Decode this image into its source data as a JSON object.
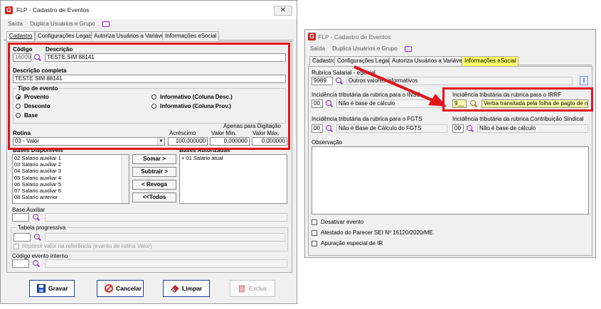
{
  "left_window": {
    "title": "FLP - Cadastro de Eventos",
    "close_label": "✕",
    "menu": {
      "saida": "Saída",
      "duplica": "Duplica Usuários e Grupo"
    },
    "tabs": [
      "Cadastro",
      "Configurações Legais",
      "Autoriza Usuários a Variáveis",
      "Informações eSocial"
    ],
    "codigo_label": "Código",
    "descricao_label": "Descrição",
    "codigo_value": "16000",
    "descricao_value": "TESTE SIM 88141",
    "descricao_completa_label": "Descrição completa",
    "descricao_completa_value": "TESTE SIM 88141",
    "tipo_evento_label": "Tipo de evento",
    "radios": {
      "provento": "Provento",
      "desconto": "Desconto",
      "base": "Base",
      "info_desc": "Informativo (Coluna Desc.)",
      "info_prov": "Informativo (Coluna Prov.)"
    },
    "apenas_digitacao": "Apenas para Digitação",
    "rotina_label": "Rotina",
    "acrescimo_label": "Acréscimo",
    "valor_min_label": "Valor Min.",
    "valor_max_label": "Valor Máx.",
    "rotina_value": "03 - Valor",
    "acrescimo_value": "100,000000",
    "valor_min_value": "0,000000",
    "valor_max_value": "0,000000",
    "bases_disponiveis_label": "Bases Disponíveis",
    "bases_autorizadas_label": "Bases Autorizadas",
    "bases_disponiveis": [
      "02 Salario auxiliar 1",
      "03 Salario auxiliar 2",
      "04 Salario auxiliar 3",
      "05 Salario auxiliar 4",
      "06 Salario auxiliar 5",
      "07 Salario auxiliar 6",
      "08 Salario anterior"
    ],
    "bases_autorizadas": [
      "+ 01 Salario atual"
    ],
    "btn_somar": "Somar >",
    "btn_subtrair": "Subtrair >",
    "btn_revoga": "< Revoga",
    "btn_todos": "<<Todos",
    "base_auxiliar_label": "Base Auxiliar",
    "tabela_progressiva_label": "Tabela progressiva",
    "imprimir_label": "Imprimir valor na referência (evento de rotina Valor)",
    "codigo_interno_label": "Código evento interno",
    "btn_gravar": "Gravar",
    "btn_cancelar": "Cancelar",
    "btn_limpar": "Limpar",
    "btn_excluir": "Excluir"
  },
  "right_window": {
    "title": "FLP - Cadastro de Eventos",
    "menu": {
      "saida": "Saída",
      "duplica": "Duplica Usuários e Grupo"
    },
    "tabs": [
      "Cadastro",
      "Configurações Legais",
      "Autoriza Usuários a Variáveis",
      "Informações eSocial"
    ],
    "rubrica_label": "Rubrica Salarial - eSocial",
    "rubrica_code": "9989",
    "rubrica_desc": "Outros valores informativos",
    "inss_label": "Incidência tributária da rubrica para o INSS",
    "inss_code": "00",
    "inss_desc": "Não é base de cálculo",
    "irrf_label": "Incidência tributária da rubrica para o IRRF",
    "irrf_code": "9__",
    "irrf_desc": "Verba transitada pela folha de pagto de natu",
    "fgts_label": "Incidência tributária da rubrica para o FGTS",
    "fgts_code": "00",
    "fgts_desc": "Não é Base de Cálculo do FGTS",
    "sindical_label": "Incidência tributária da rubrica Contribuição Sindical",
    "sindical_code": "00",
    "sindical_desc": "Não é base de cálculo",
    "observacao_label": "Observação",
    "info_icon_label": "i",
    "checks": [
      "Desativar evento",
      "Atestado do Parecer SEI Nº 16120/2020/ME.",
      "Apuração especial de IR"
    ]
  },
  "colors": {
    "highlight_red": "#e0141a",
    "tab_yellow": "#ffff66",
    "field_yellow": "#ffffa8"
  }
}
